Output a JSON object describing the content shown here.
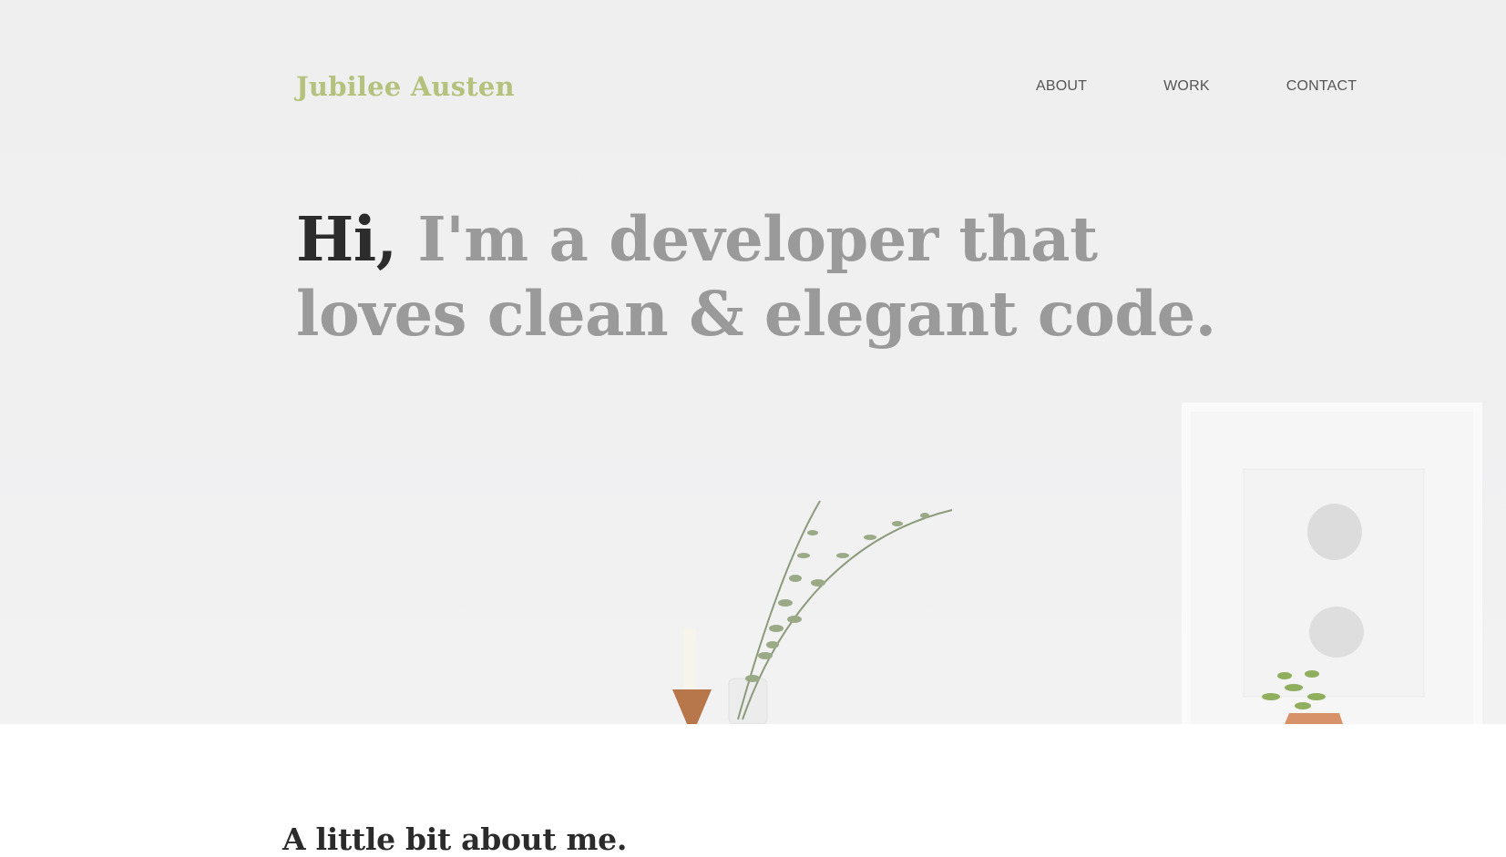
{
  "header": {
    "brand": "Jubilee Austen",
    "nav": [
      {
        "label": "ABOUT"
      },
      {
        "label": "WORK"
      },
      {
        "label": "CONTACT"
      }
    ]
  },
  "hero": {
    "greeting": "Hi,",
    "tagline": " I'm a developer that loves clean & elegant code."
  },
  "about": {
    "title": "A little bit about me."
  },
  "colors": {
    "brand": "#b4c27d",
    "headline_dark": "#2c2c2c",
    "headline_muted": "#9a9a9a",
    "nav_text": "#555555"
  }
}
